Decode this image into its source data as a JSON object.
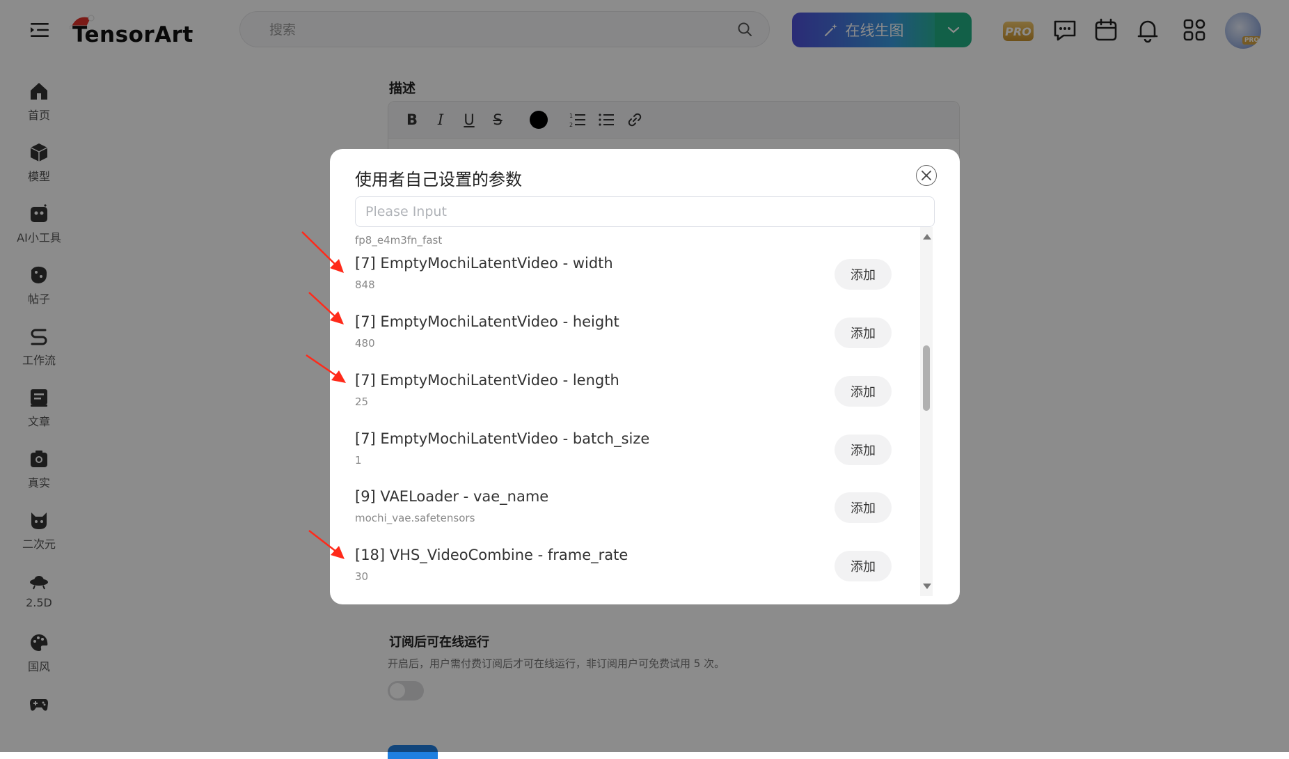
{
  "header": {
    "logo_text": "TensorArt",
    "search_placeholder": "搜索",
    "generate_label": "在线生图",
    "pro_label": "PRO",
    "avatar_badge": "PRO"
  },
  "sidebar": {
    "items": [
      {
        "label": "首页",
        "icon": "home-icon"
      },
      {
        "label": "模型",
        "icon": "cube-icon"
      },
      {
        "label": "AI小工具",
        "icon": "tools-icon"
      },
      {
        "label": "帖子",
        "icon": "post-icon"
      },
      {
        "label": "工作流",
        "icon": "workflow-icon"
      },
      {
        "label": "文章",
        "icon": "article-icon"
      },
      {
        "label": "真实",
        "icon": "camera-icon"
      },
      {
        "label": "二次元",
        "icon": "cat-icon"
      },
      {
        "label": "2.5D",
        "icon": "ufo-icon"
      },
      {
        "label": "国风",
        "icon": "palette-icon"
      },
      {
        "label": "",
        "icon": "gamepad-icon"
      }
    ]
  },
  "main": {
    "description_title": "描述",
    "subscription_title": "订阅后可在线运行",
    "subscription_desc": "开启后，用户需付费订阅后才可在线运行，非订阅用户可免费试用 5 次。"
  },
  "modal": {
    "title": "使用者自己设置的参数",
    "search_placeholder": "Please Input",
    "partial_top_value": "fp8_e4m3fn_fast",
    "add_label": "添加",
    "rows": [
      {
        "name": "[7] EmptyMochiLatentVideo - width",
        "value": "848"
      },
      {
        "name": "[7] EmptyMochiLatentVideo - height",
        "value": "480"
      },
      {
        "name": "[7] EmptyMochiLatentVideo - length",
        "value": "25"
      },
      {
        "name": "[7] EmptyMochiLatentVideo - batch_size",
        "value": "1"
      },
      {
        "name": "[9] VAELoader - vae_name",
        "value": "mochi_vae.safetensors"
      },
      {
        "name": "[18] VHS_VideoCombine - frame_rate",
        "value": "30"
      }
    ]
  },
  "colors": {
    "annotation_arrow": "#ff2a1a",
    "generate_gradient_start": "#4f4fd8",
    "generate_gradient_end": "#21b083"
  }
}
